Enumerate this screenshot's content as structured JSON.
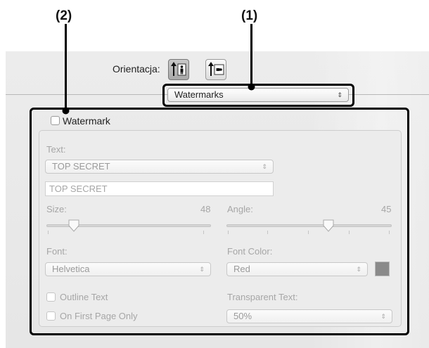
{
  "callouts": {
    "one": "(1)",
    "two": "(2)"
  },
  "orientation": {
    "label": "Orientacja:",
    "portrait_icon": "portrait-icon",
    "landscape_icon": "landscape-icon"
  },
  "panel_menu": {
    "value": "Watermarks"
  },
  "watermark": {
    "checkbox_label": "Watermark",
    "checked": false,
    "text_label": "Text:",
    "text_select": "TOP SECRET",
    "text_field": "TOP SECRET",
    "size_label": "Size:",
    "size_value": "48",
    "angle_label": "Angle:",
    "angle_value": "45",
    "font_label": "Font:",
    "font_select": "Helvetica",
    "font_color_label": "Font Color:",
    "font_color_select": "Red",
    "color_swatch": "#8a8a8a",
    "outline_label": "Outline Text",
    "first_page_label": "On First Page Only",
    "transparent_label": "Transparent Text:",
    "transparent_select": "50%"
  }
}
